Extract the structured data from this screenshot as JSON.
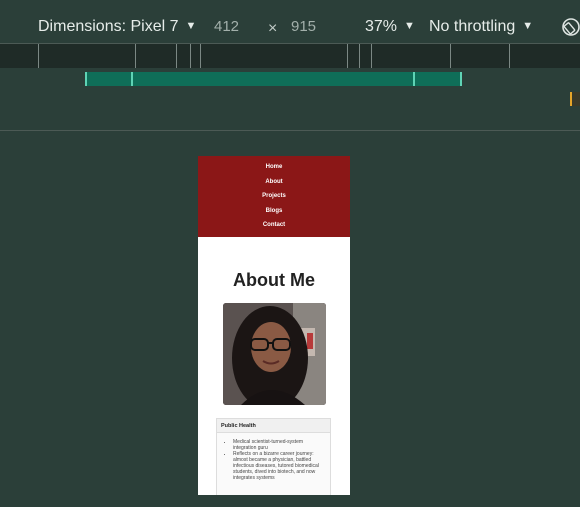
{
  "toolbar": {
    "dimensions_label": "Dimensions: Pixel 7",
    "width": "412",
    "height": "915",
    "times": "×",
    "zoom": "37%",
    "throttling": "No throttling"
  },
  "site": {
    "nav": [
      "Home",
      "About",
      "Projects",
      "Blogs",
      "Contact"
    ],
    "title": "About Me",
    "card": {
      "heading": "Public Health",
      "items": [
        "Medical scientist-turned-system integration guru",
        "Reflects on a bizarre career journey: almost became a physician, battled infectious diseases, tutored biomedical students, dived into biotech, and now integrates systems"
      ]
    }
  },
  "colors": {
    "nav_bg": "#8b1717",
    "mq_bar": "#0f6e58",
    "mq_edge": "#5fd3b5"
  }
}
